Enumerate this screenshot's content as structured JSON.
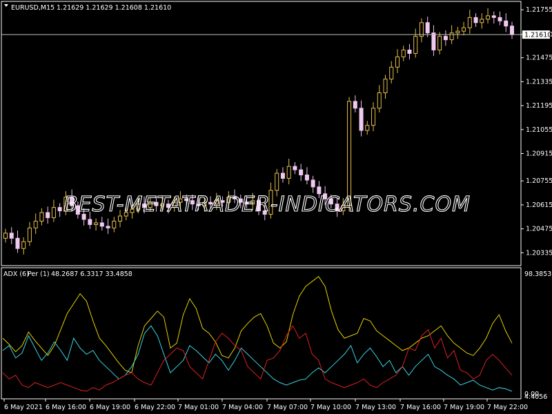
{
  "header": {
    "symbol": "EURUSD,M15",
    "ohlc": "1.21629 1.21629 1.21608 1.21610",
    "current_price": "1.21610"
  },
  "indicator": {
    "name": "ADX (6)",
    "per": "Per (1)",
    "values": "48.2687 6.3317 33.4858",
    "scale_max": "98.3853",
    "scale_min": "4.4056",
    "scale_zero": "0.00"
  },
  "watermark": "BEST-METATRADER-INDICATORS.COM",
  "colors": {
    "background": "#000000",
    "grid": "#ffffff",
    "bull_candle": "#e6c04a",
    "bear_candle": "#f0c8f0",
    "adx_line": "#e6d200",
    "plus_di": "#3ad7e6",
    "minus_di": "#e02020"
  },
  "chart_data": [
    {
      "type": "candlestick",
      "price_axis_ticks": [
        "1.21755",
        "1.21610",
        "1.21475",
        "1.21335",
        "1.21195",
        "1.21055",
        "1.20915",
        "1.20755",
        "1.20615",
        "1.20475",
        "1.20335"
      ],
      "time_axis_ticks": [
        "6 May 2021",
        "6 May 16:00",
        "6 May 19:00",
        "6 May 22:00",
        "7 May 01:00",
        "7 May 04:00",
        "7 May 07:00",
        "7 May 10:00",
        "7 May 13:00",
        "7 May 16:00",
        "7 May 19:00",
        "7 May 22:00"
      ],
      "ylim": [
        1.2028,
        1.2178
      ],
      "closes": [
        1.2045,
        1.2042,
        1.2036,
        1.204,
        1.2048,
        1.2052,
        1.2057,
        1.2054,
        1.206,
        1.2058,
        1.2066,
        1.2061,
        1.2056,
        1.2053,
        1.205,
        1.2051,
        1.2049,
        1.2048,
        1.2052,
        1.2055,
        1.2057,
        1.2059,
        1.2062,
        1.206,
        1.2063,
        1.2061,
        1.2062,
        1.206,
        1.2063,
        1.2065,
        1.2064,
        1.2062,
        1.2061,
        1.2063,
        1.2062,
        1.2064,
        1.2063,
        1.2066,
        1.2065,
        1.2063,
        1.2062,
        1.2064,
        1.2058,
        1.2056,
        1.207,
        1.208,
        1.2077,
        1.2084,
        1.2082,
        1.2079,
        1.2076,
        1.2072,
        1.2068,
        1.2065,
        1.2062,
        1.2058,
        1.2061,
        1.2122,
        1.2118,
        1.2105,
        1.2108,
        1.2118,
        1.2127,
        1.2135,
        1.2142,
        1.2148,
        1.2152,
        1.215,
        1.216,
        1.2168,
        1.2162,
        1.2152,
        1.216,
        1.2158,
        1.2162,
        1.2163,
        1.2165,
        1.2171,
        1.2168,
        1.217,
        1.2172,
        1.2171,
        1.2169,
        1.2166,
        1.2161
      ]
    },
    {
      "type": "line",
      "ylim": [
        0,
        98.3853
      ],
      "series": [
        {
          "name": "ADX (6)",
          "values": [
            48,
            43,
            37,
            42,
            53,
            46,
            40,
            34,
            42,
            55,
            68,
            76,
            84,
            78,
            62,
            48,
            42,
            35,
            28,
            22,
            20,
            42,
            58,
            64,
            70,
            65,
            40,
            44,
            67,
            80,
            72,
            56,
            52,
            45,
            34,
            32,
            40,
            54,
            60,
            65,
            68,
            58,
            44,
            40,
            45,
            67,
            82,
            90,
            94,
            98,
            90,
            70,
            55,
            48,
            50,
            52,
            64,
            62,
            54,
            50,
            46,
            42,
            38,
            40,
            44,
            48,
            50,
            54,
            58,
            50,
            44,
            40,
            36,
            34,
            40,
            48,
            60,
            67,
            54,
            44
          ]
        },
        {
          "name": "+DI",
          "values": [
            38,
            42,
            32,
            36,
            50,
            40,
            30,
            36,
            45,
            38,
            30,
            48,
            40,
            35,
            38,
            30,
            25,
            20,
            15,
            18,
            25,
            35,
            52,
            58,
            50,
            35,
            20,
            25,
            30,
            42,
            38,
            33,
            28,
            35,
            30,
            22,
            30,
            40,
            35,
            30,
            25,
            20,
            15,
            12,
            10,
            12,
            14,
            15,
            20,
            24,
            20,
            25,
            30,
            35,
            42,
            28,
            35,
            40,
            33,
            25,
            30,
            20,
            25,
            18,
            25,
            30,
            35,
            25,
            22,
            18,
            15,
            10,
            12,
            14,
            10,
            8,
            6,
            8,
            7,
            5
          ]
        },
        {
          "name": "-DI",
          "values": [
            20,
            15,
            18,
            10,
            8,
            12,
            10,
            8,
            10,
            12,
            10,
            8,
            6,
            5,
            8,
            6,
            10,
            12,
            15,
            18,
            20,
            15,
            12,
            10,
            20,
            30,
            35,
            40,
            38,
            25,
            20,
            15,
            30,
            45,
            52,
            48,
            42,
            38,
            25,
            20,
            15,
            30,
            32,
            38,
            50,
            58,
            48,
            52,
            35,
            30,
            15,
            12,
            10,
            8,
            10,
            12,
            15,
            10,
            8,
            12,
            15,
            18,
            25,
            40,
            38,
            50,
            55,
            40,
            48,
            32,
            38,
            22,
            20,
            15,
            18,
            30,
            35,
            30,
            24,
            18
          ]
        }
      ]
    }
  ]
}
